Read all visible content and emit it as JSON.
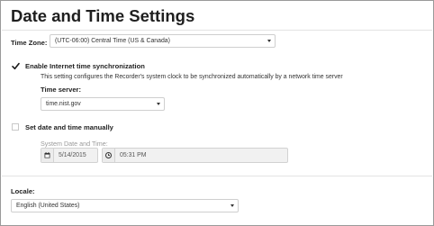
{
  "page": {
    "title": "Date and Time Settings"
  },
  "timezone": {
    "label": "Time Zone:",
    "value": "(UTC-06:00) Central Time (US & Canada)"
  },
  "internet_sync": {
    "checked": true,
    "label": "Enable Internet time synchronization",
    "description": "This setting configures the Recorder's system clock to be synchronized automatically by a network time server",
    "server_label": "Time server:",
    "server_value": "time.nist.gov"
  },
  "manual": {
    "checked": false,
    "label": "Set date and time manually",
    "system_label": "System Date and Time:",
    "date_value": "5/14/2015",
    "time_value": "05:31 PM"
  },
  "locale": {
    "label": "Locale:",
    "value": "English (United States)"
  },
  "icons": {
    "checkmark": "checkmark-icon",
    "calendar": "calendar-icon",
    "clock": "clock-icon",
    "dropdown": "chevron-down-icon"
  }
}
